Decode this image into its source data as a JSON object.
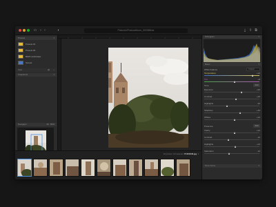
{
  "window": {
    "address": "Pictures/PhotosAlbum_003385me"
  },
  "left_panel": {
    "presets_header": "Presets",
    "presets": [
      {
        "name": "Presets #1"
      },
      {
        "name": "Presets #4"
      },
      {
        "name": "B&W Landscape"
      },
      {
        "name": "Sunset"
      }
    ],
    "user_label": "User",
    "snapshots_header": "Snapshots",
    "navigator_header": "Navigator",
    "navigator_fit": "Fit",
    "navigator_zoom": "50%"
  },
  "right_panel": {
    "histogram_header": "Histogram",
    "basic_header": "Basic",
    "white_balance_label": "White balance",
    "white_balance_value": "Custom",
    "tone_label": "Tone",
    "tone_auto": "Auto",
    "presence_label": "Presence",
    "presence_auto": "Auto",
    "tone_curve_header": "Tone Curve",
    "adjustments": [
      {
        "label": "Temperature",
        "value": "+12",
        "level": 0.88,
        "group": "wb",
        "color": "#d8c85a"
      },
      {
        "label": "Tint",
        "value": "+8",
        "level": 0.55,
        "group": "wb",
        "color": "#b05ab5"
      },
      {
        "label": "Exposure",
        "value": "+32",
        "level": 0.68,
        "group": "tone",
        "color": "#a7a7a7"
      },
      {
        "label": "Contrast",
        "value": "+16",
        "level": 0.58,
        "group": "tone",
        "color": "#a7a7a7"
      },
      {
        "label": "Highlights",
        "value": "-22",
        "level": 0.42,
        "group": "tone",
        "color": "#a7a7a7"
      },
      {
        "label": "Shadows",
        "value": "+34",
        "level": 0.66,
        "group": "tone",
        "color": "#a7a7a7"
      },
      {
        "label": "Whites",
        "value": "+12",
        "level": 0.55,
        "group": "tone",
        "color": "#a7a7a7"
      },
      {
        "label": "Clarity",
        "value": "+12",
        "level": 0.56,
        "group": "presence",
        "color": "#a7a7a7"
      },
      {
        "label": "Contrast",
        "value": "-12",
        "level": 0.44,
        "group": "presence",
        "color": "#a7a7a7"
      },
      {
        "label": "Highlights",
        "value": "+14",
        "level": 0.57,
        "group": "presence",
        "color": "#a7a7a7"
      },
      {
        "label": "Saturation",
        "value": "-12",
        "level": 0.45,
        "group": "presence",
        "color": "#a7a7a7"
      }
    ]
  },
  "filmstrip": {
    "count_text": "10 photos / 24 selected",
    "current_file": "P1000348.jpg",
    "selected_index": 0
  },
  "colors": {
    "accent": "#4a90e2",
    "dot_red": "#e0443e",
    "dot_yellow": "#dea123",
    "dot_green": "#1aab29"
  }
}
